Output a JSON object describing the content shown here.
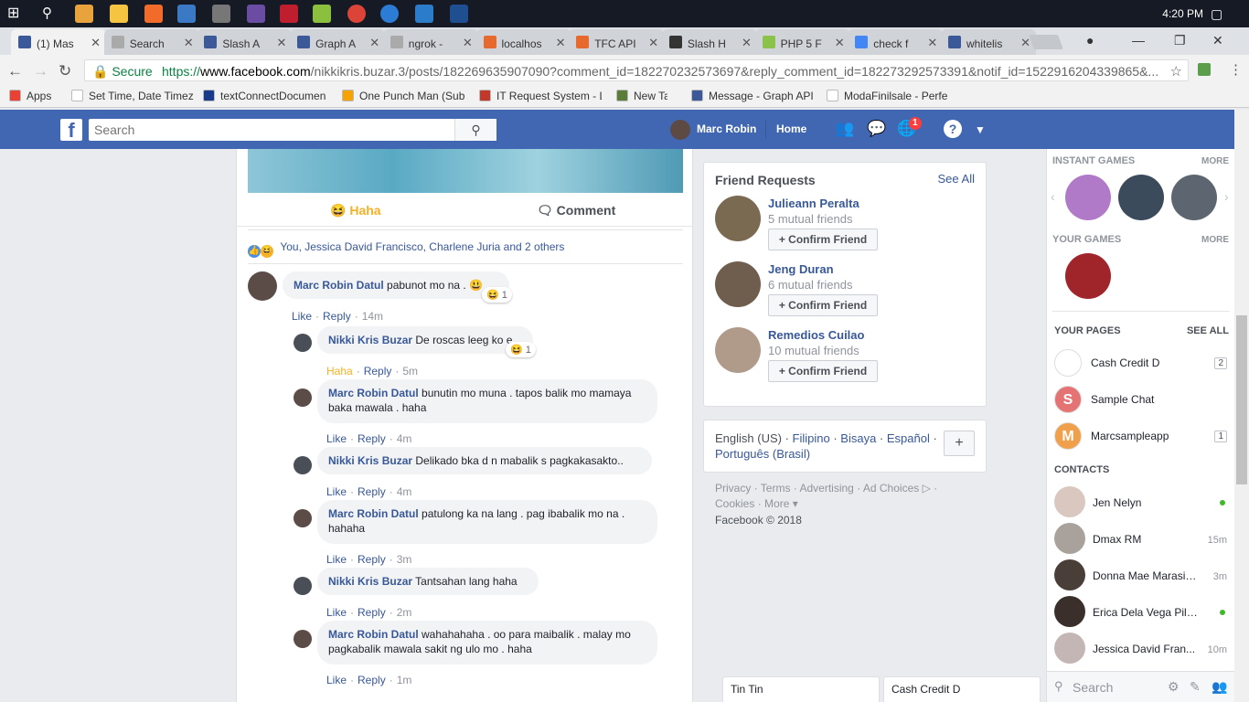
{
  "taskbar": {
    "time": "4:20 PM"
  },
  "tabs": [
    {
      "label": "(1) Mas",
      "color": "#3b5998",
      "active": true
    },
    {
      "label": "Search",
      "color": "#aaaaaa"
    },
    {
      "label": "Slash A",
      "color": "#3b5998"
    },
    {
      "label": "Graph A",
      "color": "#3b5998"
    },
    {
      "label": "ngrok -",
      "color": "#aaaaaa"
    },
    {
      "label": "localhos",
      "color": "#e8692d"
    },
    {
      "label": "TFC API",
      "color": "#e8692d"
    },
    {
      "label": "Slash H",
      "color": "#333333"
    },
    {
      "label": "PHP 5 F",
      "color": "#8bc34a"
    },
    {
      "label": "check f",
      "color": "#4285f4"
    },
    {
      "label": "whitelis",
      "color": "#3b5998"
    }
  ],
  "address": {
    "secure_label": "Secure",
    "url_prefix": "https://",
    "url_host": "www.facebook.com",
    "url_path": "/nikkikris.buzar.3/posts/182269635907090?comment_id=182270232573697&reply_comment_id=182273292573391&notif_id=1522916204339865&..."
  },
  "bookmarks": [
    {
      "label": "Apps",
      "color": "#e94235"
    },
    {
      "label": "Set Time, Date Timez",
      "color": "#ffffff"
    },
    {
      "label": "textConnectDocumen",
      "color": "#1a3a8a"
    },
    {
      "label": "One Punch Man (Sub",
      "color": "#f4a300"
    },
    {
      "label": "IT Request System - L",
      "color": "#c0392b"
    },
    {
      "label": "New Tab",
      "color": "#5a7d3a"
    },
    {
      "label": "Message - Graph API",
      "color": "#3b5998"
    },
    {
      "label": "ModaFinilsale - Perfe",
      "color": "#ffffff"
    }
  ],
  "fb": {
    "search_placeholder": "Search",
    "user_name": "Marc Robin",
    "home": "Home",
    "notif_count": "1"
  },
  "post": {
    "haha_label": "Haha",
    "comment_label": "Comment",
    "reactions_text": "You, Jessica David Francisco, Charlene Juria and 2 others"
  },
  "comments": [
    {
      "name": "Marc Robin Datul",
      "text": "pabunot mo na .",
      "emoji": "😃",
      "react_count": "1",
      "like": "Like",
      "reply": "Reply",
      "time": "14m"
    },
    {
      "name": "Nikki Kris Buzar",
      "text": "De roscas leeg ko e",
      "react_count": "1",
      "like": "Haha",
      "reply": "Reply",
      "time": "5m"
    },
    {
      "name": "Marc Robin Datul",
      "text": "bunutin mo muna . tapos balik mo mamaya baka mawala . haha",
      "like": "Like",
      "reply": "Reply",
      "time": "4m"
    },
    {
      "name": "Nikki Kris Buzar",
      "text": "Delikado bka d n mabalik s pagkakasakto..",
      "like": "Like",
      "reply": "Reply",
      "time": "4m"
    },
    {
      "name": "Marc Robin Datul",
      "text": "patulong ka na lang . pag ibabalik mo na . hahaha",
      "like": "Like",
      "reply": "Reply",
      "time": "3m"
    },
    {
      "name": "Nikki Kris Buzar",
      "text": "Tantsahan lang haha",
      "like": "Like",
      "reply": "Reply",
      "time": "2m"
    },
    {
      "name": "Marc Robin Datul",
      "text": "wahahahaha . oo para maibalik . malay mo pagkabalik mawala sakit ng ulo mo . haha",
      "like": "Like",
      "reply": "Reply",
      "time": "1m"
    }
  ],
  "friend_requests": {
    "title": "Friend Requests",
    "see_all": "See All",
    "confirm_label": "Confirm Friend",
    "items": [
      {
        "name": "Julieann Peralta",
        "mutual": "5 mutual friends"
      },
      {
        "name": "Jeng Duran",
        "mutual": "6 mutual friends"
      },
      {
        "name": "Remedios Cuilao",
        "mutual": "10 mutual friends"
      }
    ]
  },
  "language": {
    "current": "English (US)",
    "options": [
      "Filipino",
      "Bisaya",
      "Español",
      "Português (Brasil)"
    ],
    "add": "+"
  },
  "footer": {
    "links": [
      "Privacy",
      "Terms",
      "Advertising",
      "Ad Choices",
      "Cookies",
      "More"
    ],
    "copyright": "Facebook © 2018"
  },
  "sidebar": {
    "instant_games": "INSTANT GAMES",
    "your_games": "YOUR GAMES",
    "more": "MORE",
    "your_pages": "YOUR PAGES",
    "see_all": "SEE ALL",
    "pages": [
      {
        "name": "Cash Credit D",
        "count": "2",
        "icon": "",
        "color": "#ffffff"
      },
      {
        "name": "Sample Chat",
        "icon": "S",
        "color": "#e57373"
      },
      {
        "name": "Marcsampleapp",
        "count": "1",
        "icon": "M",
        "color": "#f0a04b"
      }
    ],
    "contacts_label": "CONTACTS",
    "contacts": [
      {
        "name": "Jen Nelyn",
        "status": "online"
      },
      {
        "name": "Dmax RM",
        "status": "15m"
      },
      {
        "name": "Donna Mae Marasigan",
        "status": "3m"
      },
      {
        "name": "Erica Dela Vega Pilon",
        "status": "online"
      },
      {
        "name": "Jessica David Fran...",
        "status": "10m"
      }
    ],
    "search_placeholder": "Search"
  },
  "chat_tabs": [
    "Tin Tin",
    "Cash Credit D"
  ]
}
